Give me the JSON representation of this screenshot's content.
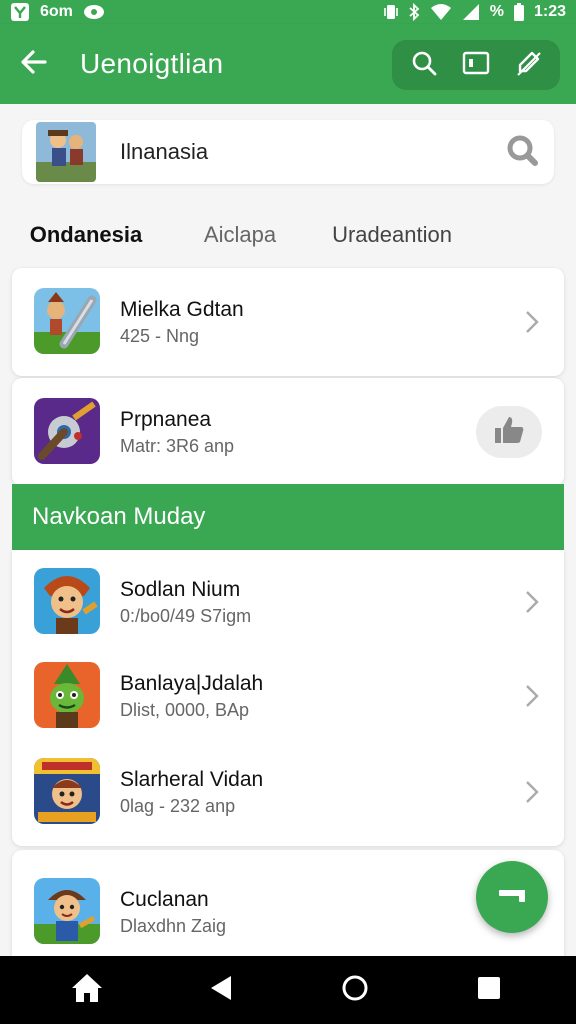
{
  "status_bar": {
    "left_text": "6om",
    "battery_text": "%",
    "time": "1:23"
  },
  "app_bar": {
    "title": "Uenoigtlian",
    "back_icon": "arrow-left-icon",
    "actions": [
      "search-icon",
      "tablet-icon",
      "edit-icon"
    ]
  },
  "search": {
    "query": "Ilnanasia",
    "icon": "search-icon"
  },
  "tabs": [
    {
      "label": "Ondanesia",
      "selected": false
    },
    {
      "label": "Aiclapa",
      "selected": false
    },
    {
      "label": "Uradeantion",
      "selected": true
    }
  ],
  "top_items": [
    {
      "title": "Mielka Gdtan",
      "subtitle": "425 - Nng",
      "action": "chevron-right-icon"
    },
    {
      "title": "Prpnanea",
      "subtitle": "Matr: 3R6 anp",
      "action": "thumbs-up-icon"
    }
  ],
  "section": {
    "title": "Navkoan Muday"
  },
  "list_items": [
    {
      "title": "Sodlan Nium",
      "subtitle": "0:/bo0/49 S7igm"
    },
    {
      "title": "Banlaya|Jdalah",
      "subtitle": "Dlist, 0000, BAp"
    },
    {
      "title": "Slarheral Vidan",
      "subtitle": "0lag - 232 anp"
    },
    {
      "title": "Cuclanan",
      "subtitle": "Dlaxdhn Zaig"
    }
  ],
  "fab_icon": "minus-icon",
  "nav_bar": [
    "home-icon",
    "back-triangle-icon",
    "home-circle-icon",
    "recents-square-icon"
  ],
  "colors": {
    "primary": "#3aa853",
    "primary_dark": "#2f8f45",
    "background": "#f5f5f5"
  }
}
